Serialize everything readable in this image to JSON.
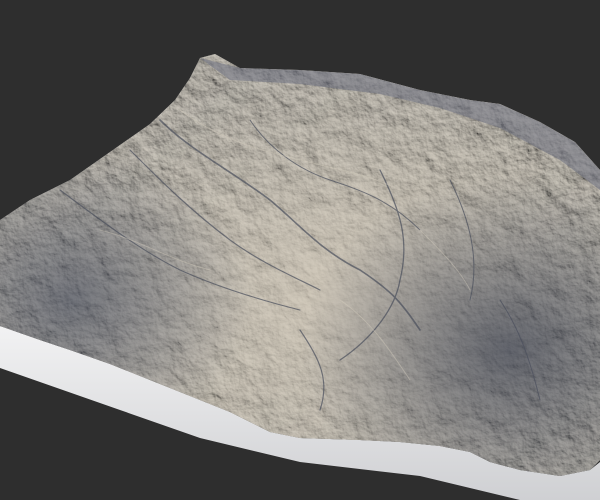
{
  "scene": {
    "background_color": "#2e2e2e",
    "subject": "3d-terrain-heightmap-render",
    "palette": {
      "lit_surface": "#b9b3a8",
      "mid_surface": "#8a8c93",
      "shadow_surface": "#5b6170",
      "deep_shadow": "#3f4554",
      "edge_skirt": "#e4e4e6"
    }
  }
}
